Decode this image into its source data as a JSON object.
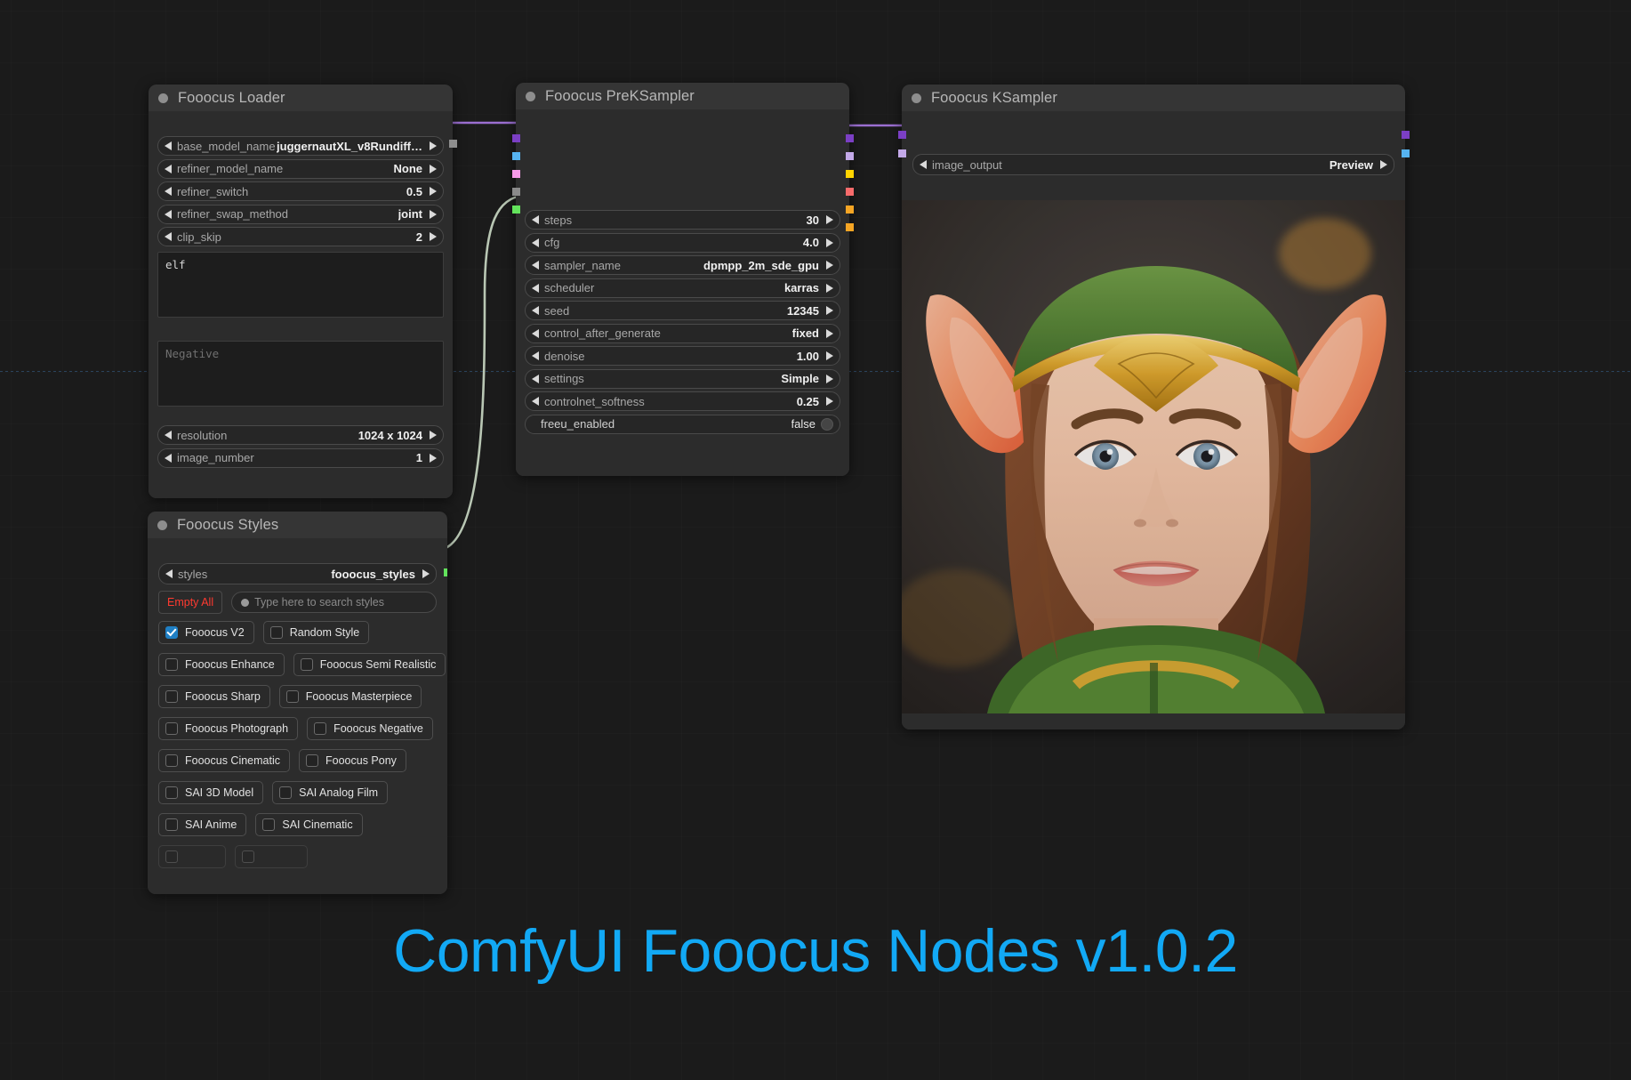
{
  "app": {
    "footer_title": "ComfyUI Fooocus Nodes v1.0.2",
    "accent_color": "#12a9f5",
    "canvas_bg": "#1b1b1b",
    "node_header_bg": "#353535",
    "node_body_bg": "#2c2c2c"
  },
  "nodes": {
    "loader": {
      "title": "Fooocus Loader",
      "widgets": [
        {
          "label": "base_model_name",
          "value": "juggernautXL_v8Rundiff…"
        },
        {
          "label": "refiner_model_name",
          "value": "None"
        },
        {
          "label": "refiner_switch",
          "value": "0.5"
        },
        {
          "label": "refiner_swap_method",
          "value": "joint"
        },
        {
          "label": "clip_skip",
          "value": "2"
        }
      ],
      "positive_prompt": "elf",
      "negative_placeholder": "Negative",
      "widgets_bottom": [
        {
          "label": "resolution",
          "value": "1024 x 1024"
        },
        {
          "label": "image_number",
          "value": "1"
        }
      ],
      "output_socket_color": "#8e8e8e"
    },
    "preksampler": {
      "title": "Fooocus PreKSampler",
      "inputs_colors": [
        "#7b3fc4",
        "#56b3f0",
        "#f79ae8",
        "#8a8a8a",
        "#63e35c"
      ],
      "outputs_colors": [
        "#7b3fc4",
        "#c3a9e8",
        "#ffd400",
        "#f76b6b",
        "#f5a524",
        "#f5a524"
      ],
      "widgets": [
        {
          "label": "steps",
          "value": "30"
        },
        {
          "label": "cfg",
          "value": "4.0"
        },
        {
          "label": "sampler_name",
          "value": "dpmpp_2m_sde_gpu"
        },
        {
          "label": "scheduler",
          "value": "karras"
        },
        {
          "label": "seed",
          "value": "12345"
        },
        {
          "label": "control_after_generate",
          "value": "fixed"
        },
        {
          "label": "denoise",
          "value": "1.00"
        },
        {
          "label": "settings",
          "value": "Simple"
        },
        {
          "label": "controlnet_softness",
          "value": "0.25"
        }
      ],
      "toggle": {
        "label": "freeu_enabled",
        "value": "false"
      }
    },
    "ksampler": {
      "title": "Fooocus KSampler",
      "inputs_colors": [
        "#7b3fc4",
        "#c3a9e8"
      ],
      "outputs_colors": [
        "#7b3fc4",
        "#56b3f0"
      ],
      "widget": {
        "label": "image_output",
        "value": "Preview"
      },
      "preview_alt": "elf woman portrait preview"
    },
    "styles": {
      "title": "Fooocus Styles",
      "output_socket_color": "#63e35c",
      "widget": {
        "label": "styles",
        "value": "fooocus_styles"
      },
      "empty_all_label": "Empty All",
      "search_placeholder": "Type here to search styles",
      "style_rows": [
        [
          {
            "label": "Fooocus V2",
            "checked": true
          },
          {
            "label": "Random Style",
            "checked": false
          }
        ],
        [
          {
            "label": "Fooocus Enhance",
            "checked": false
          },
          {
            "label": "Fooocus Semi Realistic",
            "checked": false
          }
        ],
        [
          {
            "label": "Fooocus Sharp",
            "checked": false
          },
          {
            "label": "Fooocus Masterpiece",
            "checked": false
          }
        ],
        [
          {
            "label": "Fooocus Photograph",
            "checked": false
          },
          {
            "label": "Fooocus Negative",
            "checked": false
          }
        ],
        [
          {
            "label": "Fooocus Cinematic",
            "checked": false
          },
          {
            "label": "Fooocus Pony",
            "checked": false
          }
        ],
        [
          {
            "label": "SAI 3D Model",
            "checked": false
          },
          {
            "label": "SAI Analog Film",
            "checked": false
          }
        ],
        [
          {
            "label": "SAI Anime",
            "checked": false
          },
          {
            "label": "SAI Cinematic",
            "checked": false
          }
        ]
      ]
    }
  }
}
